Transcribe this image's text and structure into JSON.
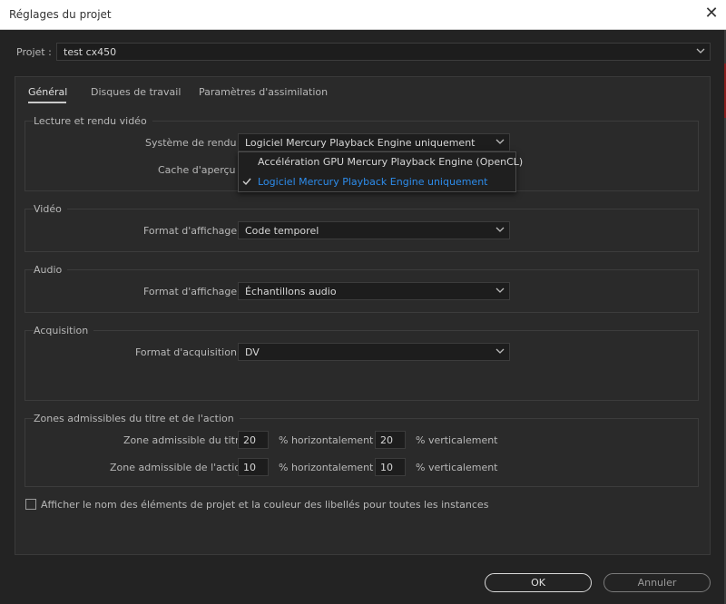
{
  "window": {
    "title": "Réglages du projet"
  },
  "project": {
    "label": "Projet :",
    "value": "test cx450"
  },
  "tabs": [
    {
      "label": "Général"
    },
    {
      "label": "Disques de travail"
    },
    {
      "label": "Paramètres d'assimilation"
    }
  ],
  "playback": {
    "title": "Lecture et rendu vidéo",
    "renderer_label": "Système de rendu :",
    "renderer_value": "Logiciel Mercury Playback Engine uniquement",
    "preview_cache_label": "Cache d'aperçu :",
    "menu_options": [
      "Accélération GPU Mercury Playback Engine (OpenCL)",
      "Logiciel Mercury Playback Engine uniquement"
    ]
  },
  "video": {
    "title": "Vidéo",
    "format_label": "Format d'affichage :",
    "format_value": "Code temporel"
  },
  "audio": {
    "title": "Audio",
    "format_label": "Format d'affichage :",
    "format_value": "Échantillons audio"
  },
  "capture": {
    "title": "Acquisition",
    "format_label": "Format d'acquisition :",
    "format_value": "DV"
  },
  "safe_zones": {
    "title": "Zones admissibles du titre et de l'action",
    "title_label": "Zone admissible du titre",
    "title_h": "20",
    "title_v": "20",
    "action_label": "Zone admissible de l'action",
    "action_h": "10",
    "action_v": "10",
    "h_label": "% horizontalement",
    "v_label": "% verticalement"
  },
  "checkbox_label": "Afficher le nom des éléments de projet et la couleur des libellés pour toutes les instances",
  "buttons": {
    "ok": "OK",
    "cancel": "Annuler"
  },
  "colors": {
    "accent": "#2d8ceb",
    "background": "#232323",
    "panel": "#2a2a2a"
  },
  "icons": [
    "close-icon",
    "chevron-down-icon",
    "checkmark-icon"
  ]
}
